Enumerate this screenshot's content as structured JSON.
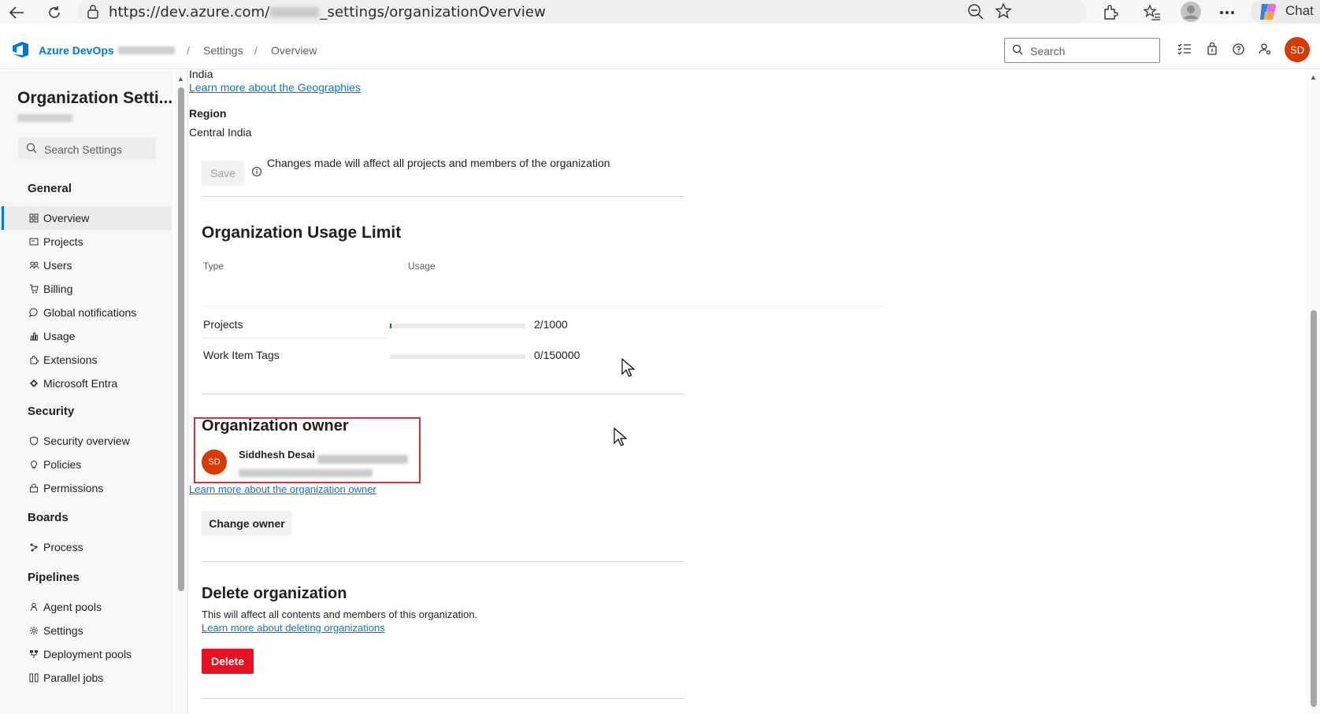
{
  "browser": {
    "url_prefix": "https://dev.azure.com/",
    "url_suffix": "_settings/organizationOverview",
    "chat_label": "Chat"
  },
  "header": {
    "brand": "Azure DevOps",
    "breadcrumb": [
      "Settings",
      "Overview"
    ],
    "search_placeholder": "Search",
    "avatar_initials": "SD"
  },
  "sidebar": {
    "title": "Organization Setti...",
    "search_placeholder": "Search Settings",
    "sections": [
      {
        "title": "General",
        "items": [
          {
            "label": "Overview",
            "icon": "grid-icon",
            "selected": true
          },
          {
            "label": "Projects",
            "icon": "projects-icon"
          },
          {
            "label": "Users",
            "icon": "users-icon"
          },
          {
            "label": "Billing",
            "icon": "cart-icon"
          },
          {
            "label": "Global notifications",
            "icon": "chat-bubble-icon"
          },
          {
            "label": "Usage",
            "icon": "bar-chart-icon"
          },
          {
            "label": "Extensions",
            "icon": "puzzle-icon"
          },
          {
            "label": "Microsoft Entra",
            "icon": "diamond-icon"
          }
        ]
      },
      {
        "title": "Security",
        "items": [
          {
            "label": "Security overview",
            "icon": "shield-icon"
          },
          {
            "label": "Policies",
            "icon": "lightbulb-icon"
          },
          {
            "label": "Permissions",
            "icon": "lock-icon"
          }
        ]
      },
      {
        "title": "Boards",
        "items": [
          {
            "label": "Process",
            "icon": "process-icon"
          }
        ]
      },
      {
        "title": "Pipelines",
        "items": [
          {
            "label": "Agent pools",
            "icon": "agent-icon"
          },
          {
            "label": "Settings",
            "icon": "gear-icon"
          },
          {
            "label": "Deployment pools",
            "icon": "deployment-icon"
          },
          {
            "label": "Parallel jobs",
            "icon": "parallel-icon"
          }
        ]
      }
    ]
  },
  "geography": {
    "value": "India",
    "learn_link": "Learn more about the Geographies",
    "region_label": "Region",
    "region_value": "Central India",
    "save_label": "Save",
    "info_text": "Changes made will affect all projects and members of the organization"
  },
  "usage_limit": {
    "title": "Organization Usage Limit",
    "col_type": "Type",
    "col_usage": "Usage",
    "rows": [
      {
        "type": "Projects",
        "usage_text": "2/1000",
        "fraction": 0.002
      },
      {
        "type": "Work Item Tags",
        "usage_text": "0/150000",
        "fraction": 0
      }
    ]
  },
  "owner": {
    "title": "Organization owner",
    "name": "Siddhesh Desai",
    "avatar_initials": "SD",
    "learn_link": "Learn more about the organization owner",
    "change_label": "Change owner"
  },
  "delete_org": {
    "title": "Delete organization",
    "description": "This will affect all contents and members of this organization.",
    "learn_link": "Learn more about deleting organizations",
    "delete_label": "Delete"
  },
  "colors": {
    "accent": "#0078d4",
    "danger": "#e81123",
    "avatar": "#d83b01",
    "highlight_box": "#d13438"
  }
}
